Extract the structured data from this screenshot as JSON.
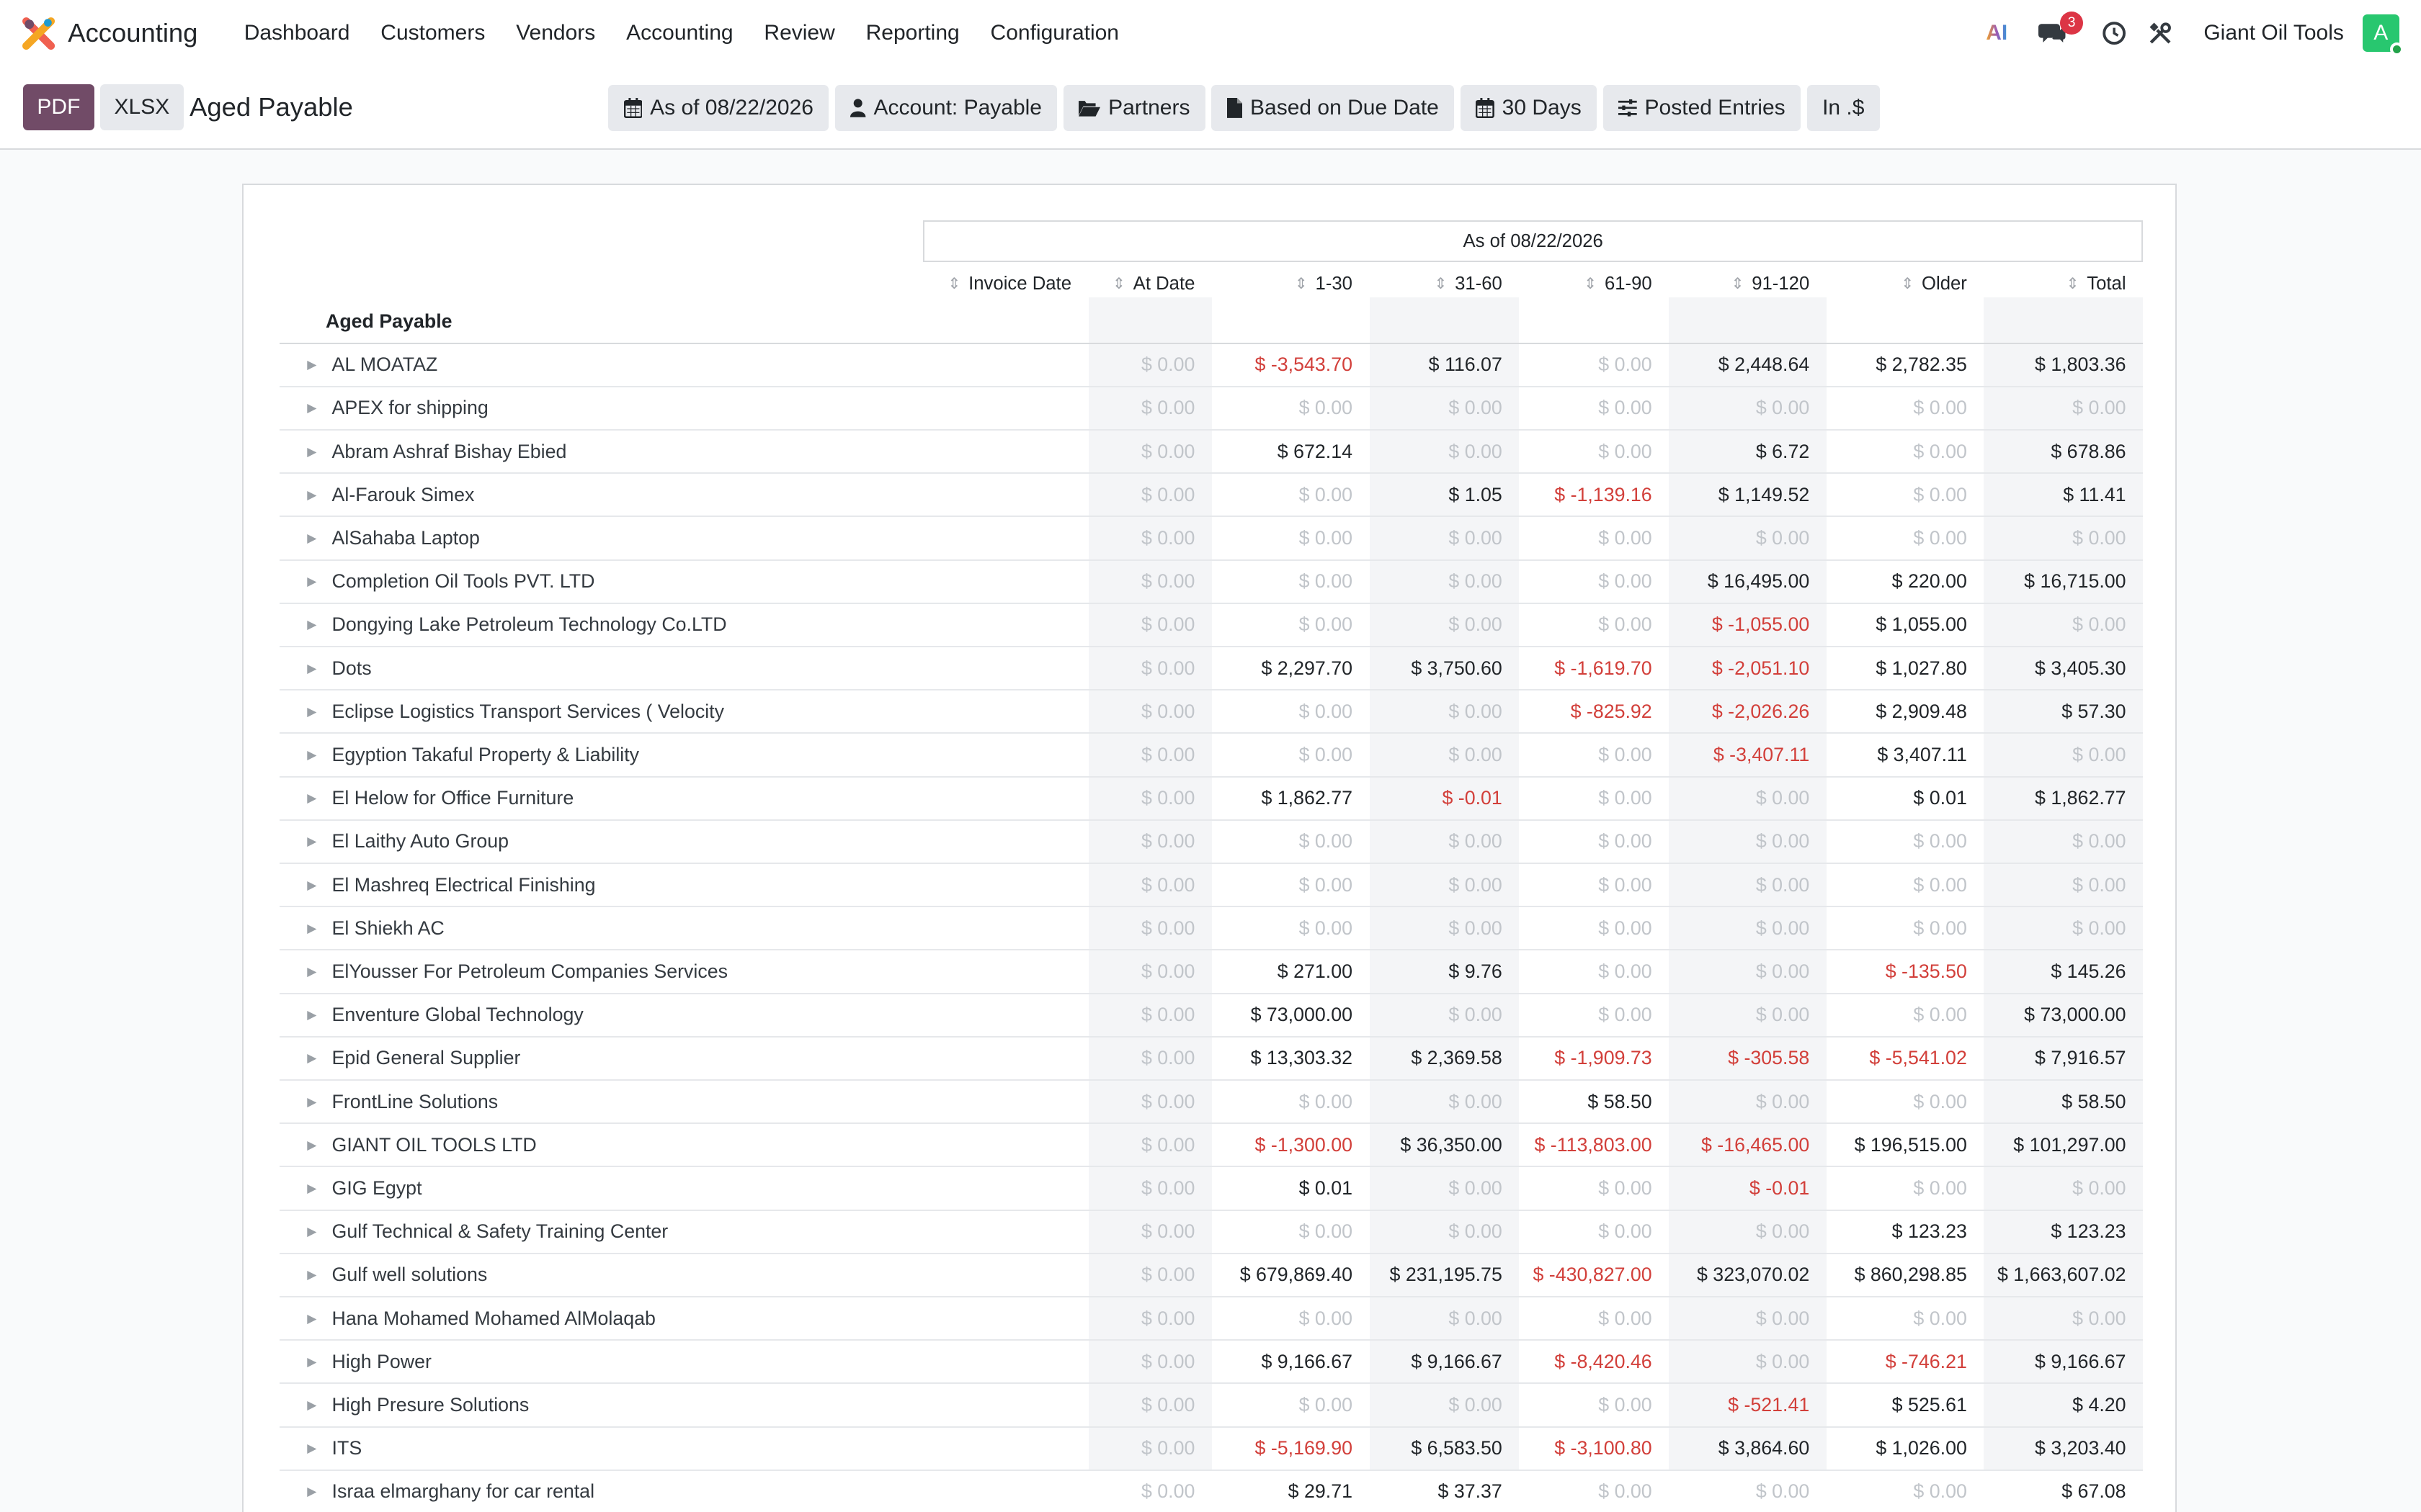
{
  "navbar": {
    "app_name": "Accounting",
    "menu": [
      "Dashboard",
      "Customers",
      "Vendors",
      "Accounting",
      "Review",
      "Reporting",
      "Configuration"
    ],
    "ai_label": "AI",
    "messages_count": "3",
    "company": "Giant Oil Tools",
    "avatar_letter": "A"
  },
  "control_panel": {
    "pdf_label": "PDF",
    "xlsx_label": "XLSX",
    "title": "Aged Payable",
    "filters": [
      {
        "icon": "calendar-icon",
        "label": "As of 08/22/2026"
      },
      {
        "icon": "user-icon",
        "label": "Account: Payable"
      },
      {
        "icon": "folder-open-icon",
        "label": "Partners"
      },
      {
        "icon": "file-icon",
        "label": "Based on Due Date"
      },
      {
        "icon": "calendar-icon",
        "label": "30 Days"
      },
      {
        "icon": "sliders-icon",
        "label": "Posted Entries"
      },
      {
        "icon": "",
        "label": "In .$"
      }
    ]
  },
  "report": {
    "header_title": "As of 08/22/2026",
    "section_title": "Aged Payable",
    "columns": [
      "Invoice Date",
      "At Date",
      "1-30",
      "31-60",
      "61-90",
      "91-120",
      "Older",
      "Total"
    ],
    "rows": [
      {
        "name": "AL MOATAZ",
        "values": [
          "$ 0.00",
          "$ -3,543.70",
          "$ 116.07",
          "$ 0.00",
          "$ 2,448.64",
          "$ 2,782.35",
          "$ 1,803.36"
        ]
      },
      {
        "name": "APEX for shipping",
        "values": [
          "$ 0.00",
          "$ 0.00",
          "$ 0.00",
          "$ 0.00",
          "$ 0.00",
          "$ 0.00",
          "$ 0.00"
        ]
      },
      {
        "name": "Abram Ashraf Bishay Ebied",
        "values": [
          "$ 0.00",
          "$ 672.14",
          "$ 0.00",
          "$ 0.00",
          "$ 6.72",
          "$ 0.00",
          "$ 678.86"
        ]
      },
      {
        "name": "Al-Farouk Simex",
        "values": [
          "$ 0.00",
          "$ 0.00",
          "$ 1.05",
          "$ -1,139.16",
          "$ 1,149.52",
          "$ 0.00",
          "$ 11.41"
        ]
      },
      {
        "name": "AlSahaba Laptop",
        "values": [
          "$ 0.00",
          "$ 0.00",
          "$ 0.00",
          "$ 0.00",
          "$ 0.00",
          "$ 0.00",
          "$ 0.00"
        ]
      },
      {
        "name": "Completion Oil Tools PVT. LTD",
        "values": [
          "$ 0.00",
          "$ 0.00",
          "$ 0.00",
          "$ 0.00",
          "$ 16,495.00",
          "$ 220.00",
          "$ 16,715.00"
        ]
      },
      {
        "name": "Dongying Lake Petroleum Technology Co.LTD",
        "values": [
          "$ 0.00",
          "$ 0.00",
          "$ 0.00",
          "$ 0.00",
          "$ -1,055.00",
          "$ 1,055.00",
          "$ 0.00"
        ]
      },
      {
        "name": "Dots",
        "values": [
          "$ 0.00",
          "$ 2,297.70",
          "$ 3,750.60",
          "$ -1,619.70",
          "$ -2,051.10",
          "$ 1,027.80",
          "$ 3,405.30"
        ]
      },
      {
        "name": "Eclipse Logistics Transport Services ( Velocity",
        "values": [
          "$ 0.00",
          "$ 0.00",
          "$ 0.00",
          "$ -825.92",
          "$ -2,026.26",
          "$ 2,909.48",
          "$ 57.30"
        ]
      },
      {
        "name": "Egyption Takaful Property & Liability",
        "values": [
          "$ 0.00",
          "$ 0.00",
          "$ 0.00",
          "$ 0.00",
          "$ -3,407.11",
          "$ 3,407.11",
          "$ 0.00"
        ]
      },
      {
        "name": "El Helow for Office Furniture",
        "values": [
          "$ 0.00",
          "$ 1,862.77",
          "$ -0.01",
          "$ 0.00",
          "$ 0.00",
          "$ 0.01",
          "$ 1,862.77"
        ]
      },
      {
        "name": "El Laithy Auto Group",
        "values": [
          "$ 0.00",
          "$ 0.00",
          "$ 0.00",
          "$ 0.00",
          "$ 0.00",
          "$ 0.00",
          "$ 0.00"
        ]
      },
      {
        "name": "El Mashreq Electrical Finishing",
        "values": [
          "$ 0.00",
          "$ 0.00",
          "$ 0.00",
          "$ 0.00",
          "$ 0.00",
          "$ 0.00",
          "$ 0.00"
        ]
      },
      {
        "name": "El Shiekh AC",
        "values": [
          "$ 0.00",
          "$ 0.00",
          "$ 0.00",
          "$ 0.00",
          "$ 0.00",
          "$ 0.00",
          "$ 0.00"
        ]
      },
      {
        "name": "ElYousser For Petroleum Companies Services",
        "values": [
          "$ 0.00",
          "$ 271.00",
          "$ 9.76",
          "$ 0.00",
          "$ 0.00",
          "$ -135.50",
          "$ 145.26"
        ]
      },
      {
        "name": "Enventure Global Technology",
        "values": [
          "$ 0.00",
          "$ 73,000.00",
          "$ 0.00",
          "$ 0.00",
          "$ 0.00",
          "$ 0.00",
          "$ 73,000.00"
        ]
      },
      {
        "name": "Epid General Supplier",
        "values": [
          "$ 0.00",
          "$ 13,303.32",
          "$ 2,369.58",
          "$ -1,909.73",
          "$ -305.58",
          "$ -5,541.02",
          "$ 7,916.57"
        ]
      },
      {
        "name": "FrontLine Solutions",
        "values": [
          "$ 0.00",
          "$ 0.00",
          "$ 0.00",
          "$ 58.50",
          "$ 0.00",
          "$ 0.00",
          "$ 58.50"
        ]
      },
      {
        "name": "GIANT OIL TOOLS LTD",
        "values": [
          "$ 0.00",
          "$ -1,300.00",
          "$ 36,350.00",
          "$ -113,803.00",
          "$ -16,465.00",
          "$ 196,515.00",
          "$ 101,297.00"
        ]
      },
      {
        "name": "GIG Egypt",
        "values": [
          "$ 0.00",
          "$ 0.01",
          "$ 0.00",
          "$ 0.00",
          "$ -0.01",
          "$ 0.00",
          "$ 0.00"
        ]
      },
      {
        "name": "Gulf Technical & Safety Training Center",
        "values": [
          "$ 0.00",
          "$ 0.00",
          "$ 0.00",
          "$ 0.00",
          "$ 0.00",
          "$ 123.23",
          "$ 123.23"
        ]
      },
      {
        "name": "Gulf well solutions",
        "values": [
          "$ 0.00",
          "$ 679,869.40",
          "$ 231,195.75",
          "$ -430,827.00",
          "$ 323,070.02",
          "$ 860,298.85",
          "$ 1,663,607.02"
        ]
      },
      {
        "name": "Hana Mohamed Mohamed AlMolaqab",
        "values": [
          "$ 0.00",
          "$ 0.00",
          "$ 0.00",
          "$ 0.00",
          "$ 0.00",
          "$ 0.00",
          "$ 0.00"
        ]
      },
      {
        "name": "High Power",
        "values": [
          "$ 0.00",
          "$ 9,166.67",
          "$ 9,166.67",
          "$ -8,420.46",
          "$ 0.00",
          "$ -746.21",
          "$ 9,166.67"
        ]
      },
      {
        "name": "High Presure Solutions",
        "values": [
          "$ 0.00",
          "$ 0.00",
          "$ 0.00",
          "$ 0.00",
          "$ -521.41",
          "$ 525.61",
          "$ 4.20"
        ]
      },
      {
        "name": "ITS",
        "values": [
          "$ 0.00",
          "$ -5,169.90",
          "$ 6,583.50",
          "$ -3,100.80",
          "$ 3,864.60",
          "$ 1,026.00",
          "$ 3,203.40"
        ]
      },
      {
        "name": "Israa elmarghany for car rental",
        "values": [
          "$ 0.00",
          "$ 29.71",
          "$ 37.37",
          "$ 0.00",
          "$ 0.00",
          "$ 0.00",
          "$ 67.08"
        ]
      }
    ]
  }
}
